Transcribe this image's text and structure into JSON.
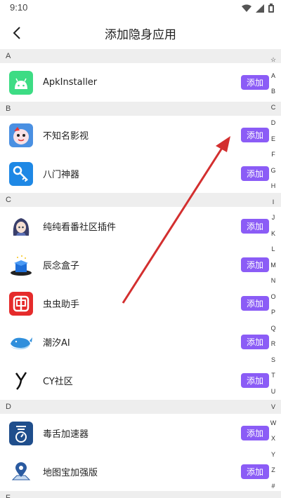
{
  "status": {
    "time": "9:10"
  },
  "header": {
    "title": "添加隐身应用"
  },
  "sections": [
    {
      "letter": "A",
      "apps": [
        {
          "name": "ApkInstaller",
          "icon": "android-icon"
        }
      ]
    },
    {
      "letter": "B",
      "apps": [
        {
          "name": "不知名影视",
          "icon": "cartoon-face-icon"
        },
        {
          "name": "八门神器",
          "icon": "key-icon"
        }
      ]
    },
    {
      "letter": "C",
      "apps": [
        {
          "name": "纯纯看番社区插件",
          "icon": "anime-girl-icon"
        },
        {
          "name": "辰念盒子",
          "icon": "blue-box-icon"
        },
        {
          "name": "虫虫助手",
          "icon": "bug-assistant-icon"
        },
        {
          "name": "潮汐AI",
          "icon": "whale-icon"
        },
        {
          "name": "CY社区",
          "icon": "y-logo-icon"
        }
      ]
    },
    {
      "letter": "D",
      "apps": [
        {
          "name": "毒舌加速器",
          "icon": "speedometer-icon"
        },
        {
          "name": "地图宝加强版",
          "icon": "map-pin-icon"
        }
      ]
    },
    {
      "letter": "F",
      "apps": []
    }
  ],
  "add_label": "添加",
  "index_letters": [
    "☆",
    "A",
    "B",
    "C",
    "D",
    "E",
    "F",
    "G",
    "H",
    "I",
    "J",
    "K",
    "L",
    "M",
    "N",
    "O",
    "P",
    "Q",
    "R",
    "S",
    "T",
    "U",
    "V",
    "W",
    "X",
    "Y",
    "Z",
    "#"
  ],
  "colors": {
    "accent": "#8b5cf6",
    "annotation_arrow": "#d32f2f"
  }
}
